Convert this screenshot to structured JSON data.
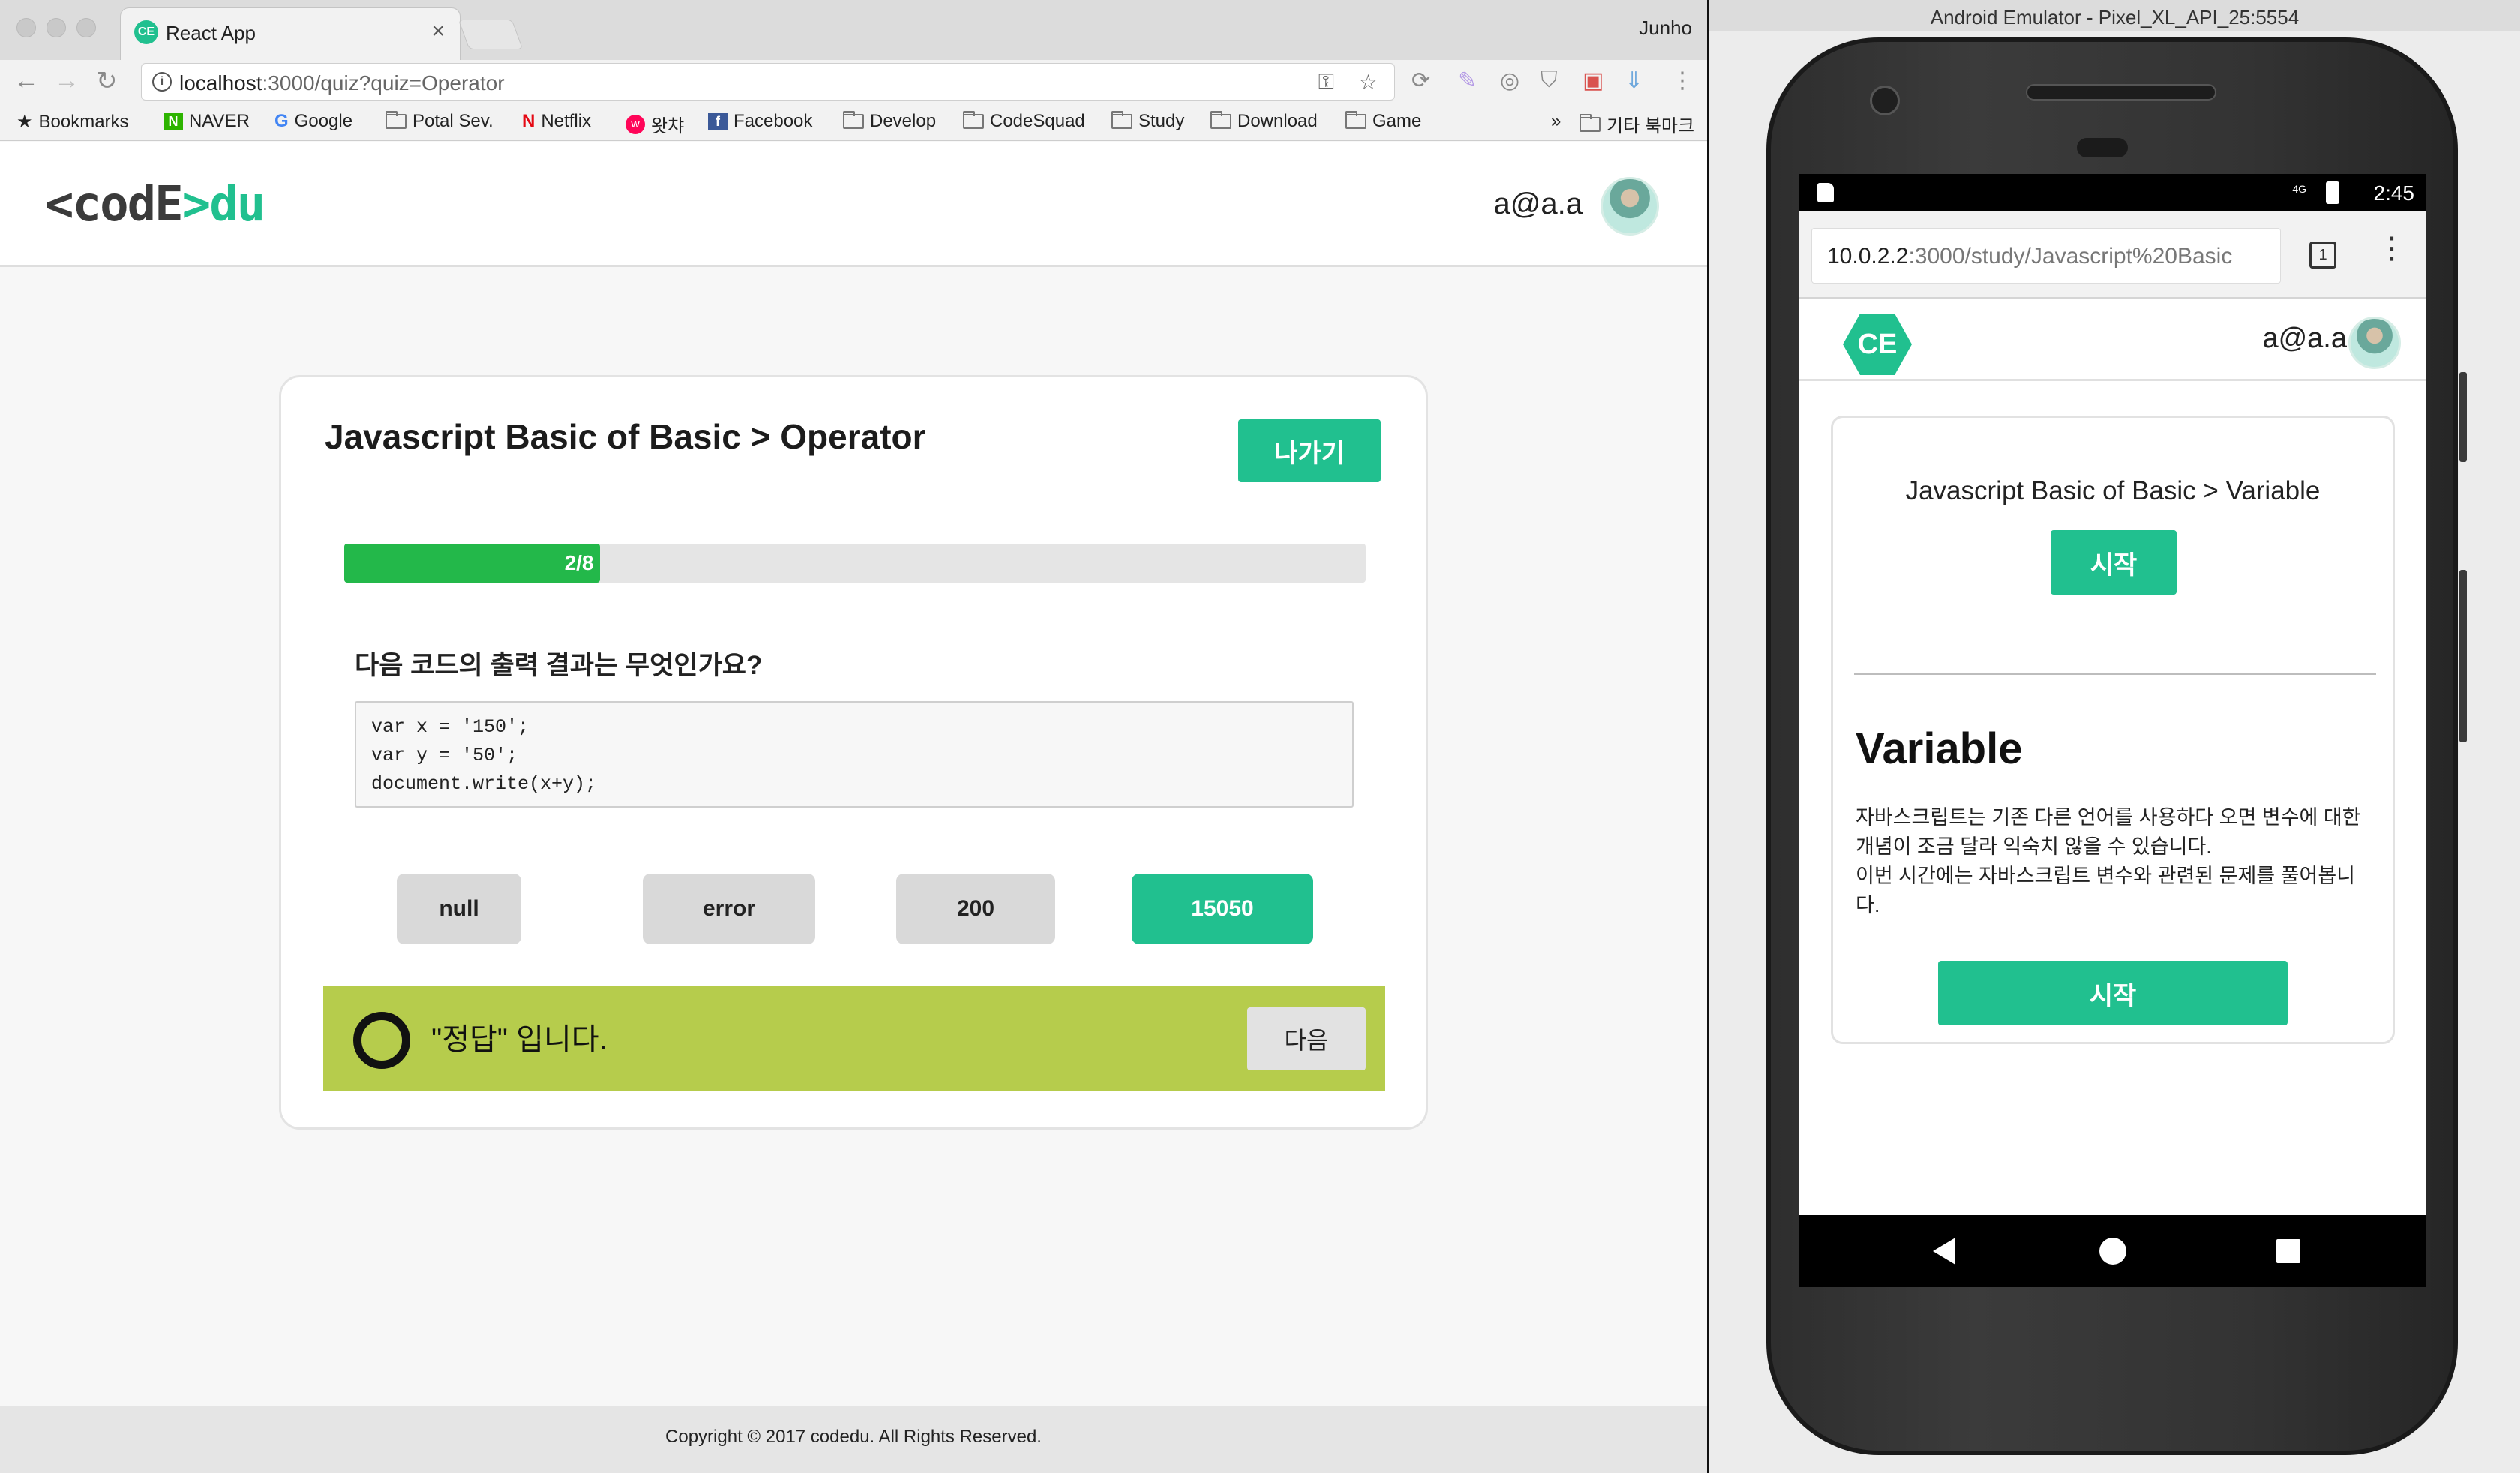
{
  "browser": {
    "tab_title": "React App",
    "tab_close": "×",
    "profile_name": "Junho",
    "url_host": "localhost",
    "url_path": ":3000/quiz?quiz=Operator",
    "bookmarks": [
      "Bookmarks",
      "NAVER",
      "Google",
      "Potal Sev.",
      "Netflix",
      "왓챠",
      "Facebook",
      "Develop",
      "CodeSquad",
      "Study",
      "Download",
      "Game"
    ],
    "bookmarks_overflow": "»",
    "other_bookmarks": "기타 북마크"
  },
  "site": {
    "logo_left": "<codE",
    "logo_right": ">du",
    "user_email": "a@a.a"
  },
  "quiz": {
    "title": "Javascript Basic of Basic > Operator",
    "exit_label": "나가기",
    "progress_label": "2/8",
    "progress_fraction": 0.25,
    "question": "다음 코드의 출력 결과는 무엇인가요?",
    "code_lines": [
      "var x = '150';",
      "var y = '50';",
      "document.write(x+y);"
    ],
    "choices": [
      "null",
      "error",
      "200",
      "15050"
    ],
    "selected_choice": "15050",
    "result_text": "\"정답\" 입니다.",
    "next_label": "다음"
  },
  "footer": {
    "copyright": "Copyright © 2017 codedu. All Rights Reserved."
  },
  "emulator": {
    "window_title": "Android Emulator - Pixel_XL_API_25:5554",
    "status_time": "2:45",
    "status_network": "4G",
    "url_host": "10.0.2.2",
    "url_path": ":3000/study/Javascript%20Basic",
    "tab_count": "1",
    "logo_text": "CE",
    "user_email": "a@a.a",
    "study_title": "Javascript Basic of Basic > Variable",
    "start_label_top": "시작",
    "heading": "Variable",
    "description_1": "자바스크립트는 기존 다른 언어를 사용하다 오면 변수에 대한 개념이 조금 달라 익숙치 않을 수 있습니다.",
    "description_2": "이번 시간에는 자바스크립트 변수와 관련된 문제를 풀어봅니다.",
    "start_label_bottom": "시작"
  },
  "colors": {
    "brand_green": "#21c08f",
    "progress_green": "#23b84a",
    "correct_bar": "#b6cc4c"
  }
}
